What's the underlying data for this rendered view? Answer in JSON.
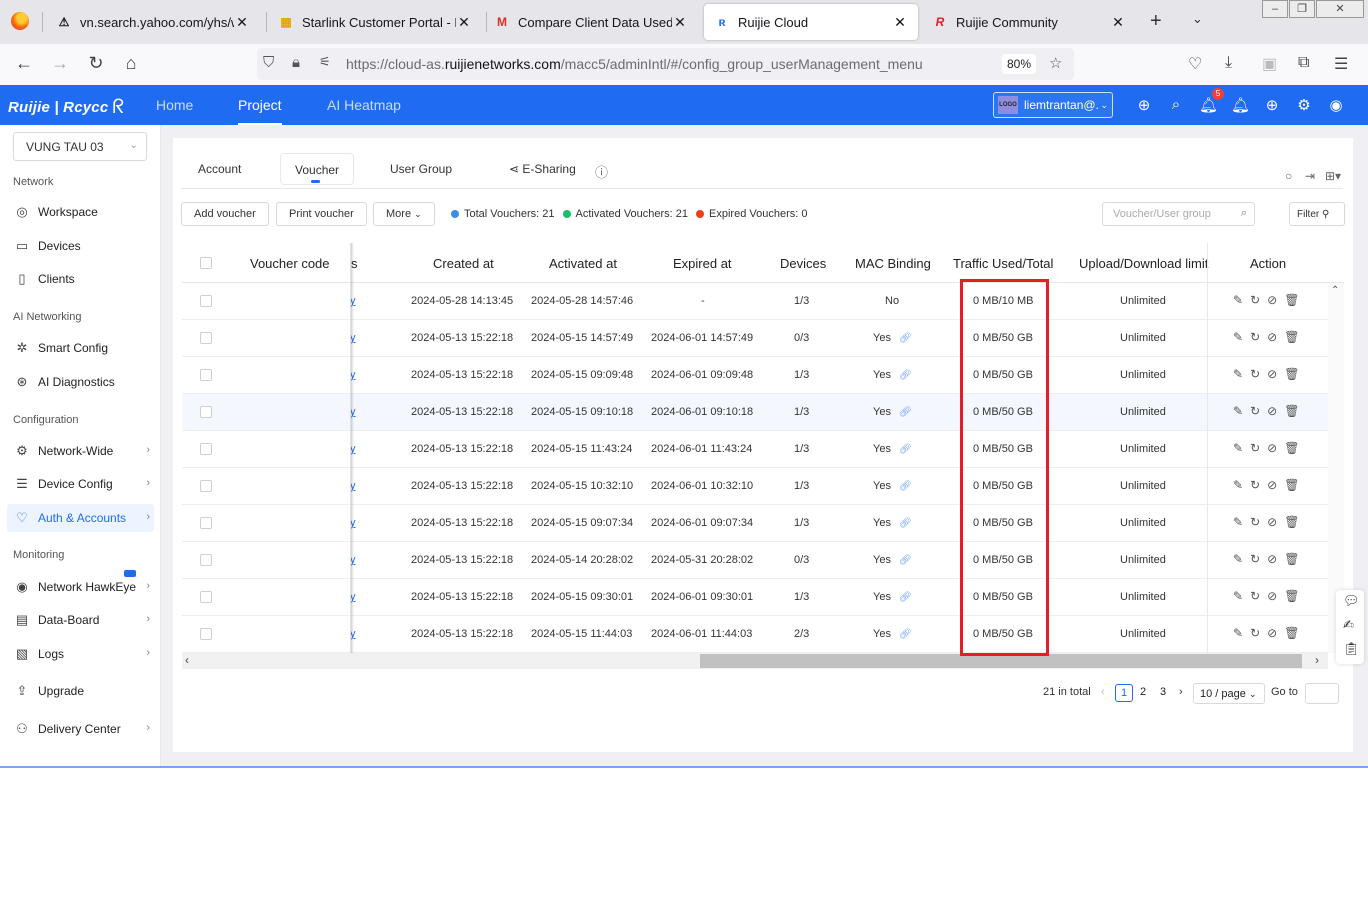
{
  "browser": {
    "tabs": [
      {
        "title": "vn.search.yahoo.com/yhs/wel",
        "icon": "⚠"
      },
      {
        "title": "Starlink Customer Portal - Rep",
        "icon": "▦"
      },
      {
        "title": "Compare Client Data Used - li",
        "icon": "M"
      },
      {
        "title": "Ruijie Cloud",
        "icon": "ʀ"
      },
      {
        "title": "Ruijie Community",
        "icon": "R"
      }
    ],
    "url_prefix": "https://cloud-as.",
    "url_domain": "ruijienetworks.com",
    "url_path": "/macc5/adminIntl/#/config_group_userManagement_menu",
    "zoom": "80%"
  },
  "header": {
    "logo": "Ruijie | Rcycc",
    "nav": [
      "Home",
      "Project",
      "AI Heatmap"
    ],
    "active_nav": "Project",
    "user": "liemtrantan@...",
    "logo_badge": "LOGO",
    "notification_count": "5",
    "accent": "#1f6cf2"
  },
  "sidebar": {
    "site": "VUNG TAU 03",
    "sections": {
      "network": "Network",
      "ai": "AI Networking",
      "config": "Configuration",
      "monitoring": "Monitoring"
    },
    "items": [
      {
        "label": "Workspace",
        "icon": "◎"
      },
      {
        "label": "Devices",
        "icon": "▭"
      },
      {
        "label": "Clients",
        "icon": "▯"
      },
      {
        "label": "Smart Config",
        "icon": "✲"
      },
      {
        "label": "AI Diagnostics",
        "icon": "⊛"
      },
      {
        "label": "Network-Wide",
        "icon": "⚙"
      },
      {
        "label": "Device Config",
        "icon": "☰"
      },
      {
        "label": "Auth & Accounts",
        "icon": "♡"
      },
      {
        "label": "Network HawkEye",
        "icon": "◉"
      },
      {
        "label": "Data-Board",
        "icon": "▤"
      },
      {
        "label": "Logs",
        "icon": "▧"
      },
      {
        "label": "Upgrade",
        "icon": "⇪"
      },
      {
        "label": "Delivery Center",
        "icon": "⚇"
      }
    ]
  },
  "content": {
    "tabs": [
      "Account",
      "Voucher",
      "User Group",
      "E-Sharing"
    ],
    "active_tab": "Voucher",
    "buttons": {
      "add": "Add voucher",
      "print": "Print voucher",
      "more": "More"
    },
    "stats": {
      "total": "Total Vouchers: 21",
      "activated": "Activated Vouchers: 21",
      "expired": "Expired Vouchers: 0",
      "total_color": "#3a8ee6",
      "activated_color": "#19be6b",
      "expired_color": "#ed3f14"
    },
    "search_placeholder": "Voucher/User group",
    "filter": "Filter",
    "columns": {
      "voucher_code": "Voucher code",
      "partial": "s",
      "created": "Created at",
      "activated": "Activated at",
      "expired": "Expired at",
      "devices": "Devices",
      "mac": "MAC Binding",
      "traffic": "Traffic Used/Total",
      "limit": "Upload/Download limit",
      "action": "Action"
    },
    "rows": [
      {
        "link": "y",
        "created": "2024-05-28 14:13:45",
        "activated": "2024-05-28 14:57:46",
        "expired": "-",
        "devices": "1/3",
        "mac": "No",
        "traffic": "0 MB/10 MB",
        "limit": "Unlimited"
      },
      {
        "link": "y",
        "created": "2024-05-13 15:22:18",
        "activated": "2024-05-15 14:57:49",
        "expired": "2024-06-01 14:57:49",
        "devices": "0/3",
        "mac": "Yes",
        "traffic": "0 MB/50 GB",
        "limit": "Unlimited"
      },
      {
        "link": "y",
        "created": "2024-05-13 15:22:18",
        "activated": "2024-05-15 09:09:48",
        "expired": "2024-06-01 09:09:48",
        "devices": "1/3",
        "mac": "Yes",
        "traffic": "0 MB/50 GB",
        "limit": "Unlimited"
      },
      {
        "link": "y",
        "created": "2024-05-13 15:22:18",
        "activated": "2024-05-15 09:10:18",
        "expired": "2024-06-01 09:10:18",
        "devices": "1/3",
        "mac": "Yes",
        "traffic": "0 MB/50 GB",
        "limit": "Unlimited"
      },
      {
        "link": "y",
        "created": "2024-05-13 15:22:18",
        "activated": "2024-05-15 11:43:24",
        "expired": "2024-06-01 11:43:24",
        "devices": "1/3",
        "mac": "Yes",
        "traffic": "0 MB/50 GB",
        "limit": "Unlimited"
      },
      {
        "link": "y",
        "created": "2024-05-13 15:22:18",
        "activated": "2024-05-15 10:32:10",
        "expired": "2024-06-01 10:32:10",
        "devices": "1/3",
        "mac": "Yes",
        "traffic": "0 MB/50 GB",
        "limit": "Unlimited"
      },
      {
        "link": "y",
        "created": "2024-05-13 15:22:18",
        "activated": "2024-05-15 09:07:34",
        "expired": "2024-06-01 09:07:34",
        "devices": "1/3",
        "mac": "Yes",
        "traffic": "0 MB/50 GB",
        "limit": "Unlimited"
      },
      {
        "link": "y",
        "created": "2024-05-13 15:22:18",
        "activated": "2024-05-14 20:28:02",
        "expired": "2024-05-31 20:28:02",
        "devices": "0/3",
        "mac": "Yes",
        "traffic": "0 MB/50 GB",
        "limit": "Unlimited"
      },
      {
        "link": "y",
        "created": "2024-05-13 15:22:18",
        "activated": "2024-05-15 09:30:01",
        "expired": "2024-06-01 09:30:01",
        "devices": "1/3",
        "mac": "Yes",
        "traffic": "0 MB/50 GB",
        "limit": "Unlimited"
      },
      {
        "link": "y",
        "created": "2024-05-13 15:22:18",
        "activated": "2024-05-15 11:44:03",
        "expired": "2024-06-01 11:44:03",
        "devices": "2/3",
        "mac": "Yes",
        "traffic": "0 MB/50 GB",
        "limit": "Unlimited"
      }
    ],
    "highlight_color": "#e31e24",
    "pagination": {
      "total": "21 in total",
      "pages": [
        "1",
        "2",
        "3"
      ],
      "current": "1",
      "page_size": "10 / page",
      "goto": "Go to"
    }
  }
}
